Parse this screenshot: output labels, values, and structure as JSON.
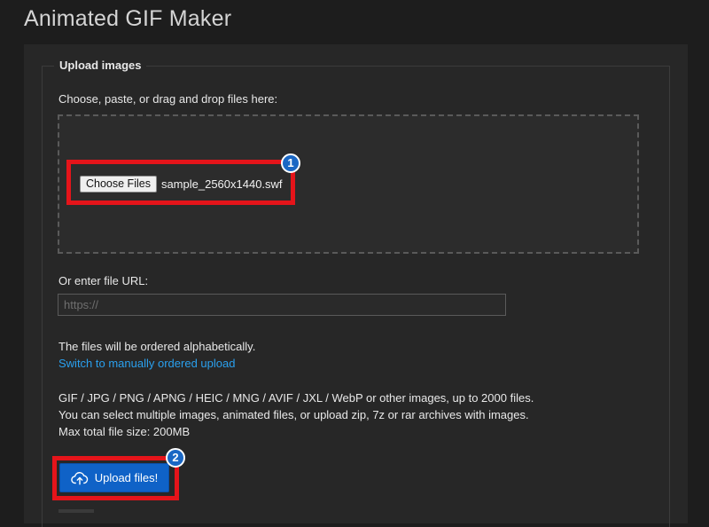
{
  "page": {
    "title": "Animated GIF Maker"
  },
  "upload": {
    "legend": "Upload images",
    "instructions": "Choose, paste, or drag and drop files here:",
    "choose_button": "Choose Files",
    "selected_file": "sample_2560x1440.swf",
    "url_label": "Or enter file URL:",
    "url_placeholder": "https://",
    "url_value": "",
    "order_note": "The files will be ordered alphabetically.",
    "order_link": "Switch to manually ordered upload",
    "formats_line": "GIF / JPG / PNG / APNG / HEIC / MNG / AVIF / JXL / WebP or other images, up to 2000 files.",
    "multi_line": "You can select multiple images, animated files, or upload zip, 7z or rar archives with images.",
    "max_size": "Max total file size: 200MB",
    "upload_button": "Upload files!",
    "upload_icon": "cloud-upload-icon"
  },
  "annotations": {
    "badge_1": "1",
    "badge_2": "2",
    "highlight_color": "#e5141a",
    "badge_color": "#1a67c4"
  },
  "colors": {
    "background": "#1d1d1d",
    "panel": "#272727",
    "link": "#2aa0ee",
    "primary_button": "#0f62c7"
  }
}
